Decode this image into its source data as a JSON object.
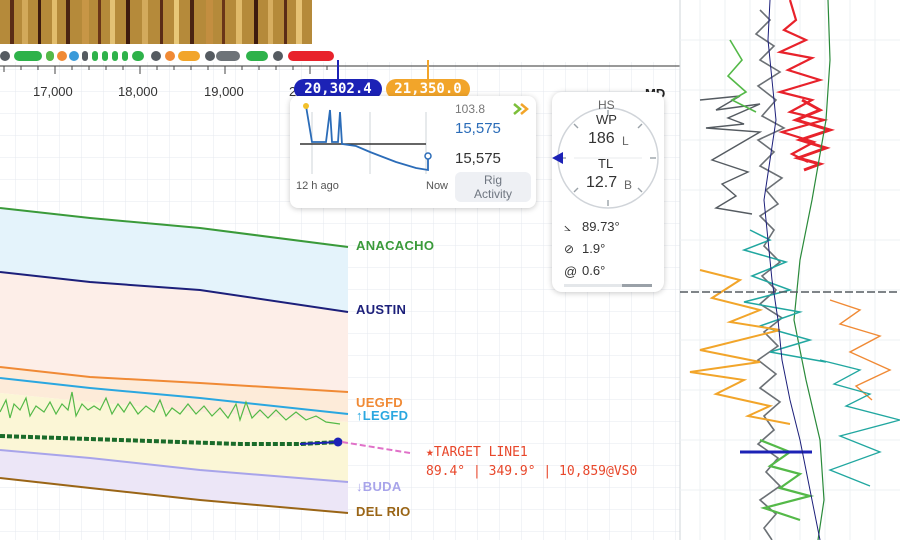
{
  "axis": {
    "depth_ticks": [
      "17,000",
      "18,000",
      "19,000",
      "2"
    ],
    "md_label": "MD"
  },
  "depth_markers": {
    "current": "20,302.4",
    "target": "21,350.0"
  },
  "rig_activity": {
    "top_value": "103.8",
    "value_primary": "15,575",
    "value_secondary": "15,575",
    "time_start": "12 h ago",
    "time_end": "Now",
    "button_line1": "Rig",
    "button_line2": "Activity"
  },
  "compass": {
    "hs_label": "HS",
    "wp_label": "WP",
    "wp_value": "186",
    "wp_suffix": "L",
    "tl_label": "TL",
    "tl_value": "12.7",
    "tl_suffix": "B",
    "inclination": "89.73°",
    "azimuth": "1.9°",
    "dogleg": "0.6°"
  },
  "formations": [
    {
      "name": "ANACACHO",
      "color": "#3a9a3a"
    },
    {
      "name": "AUSTIN",
      "color": "#1c1f7a"
    },
    {
      "name": "UEGFD",
      "color": "#f08a35"
    },
    {
      "name": "↑LEGFD",
      "color": "#2aa7e0"
    },
    {
      "name": "↓BUDA",
      "color": "#a8a4ea"
    },
    {
      "name": "DEL RIO",
      "color": "#9a6516"
    }
  ],
  "target": {
    "label": "★TARGET LINE1",
    "detail": "89.4° | 349.9° | 10,859@VS0",
    "color": "#e8472b"
  },
  "colors": {
    "grid": "#e6e9ef",
    "accent_blue": "#1c22b6",
    "accent_orange": "#f2a52a",
    "gamma_green": "#54b948"
  },
  "icons": [
    "inclination-icon",
    "azimuth-icon",
    "dogleg-icon",
    "chevron-right-icon",
    "compass-pointer-icon"
  ]
}
